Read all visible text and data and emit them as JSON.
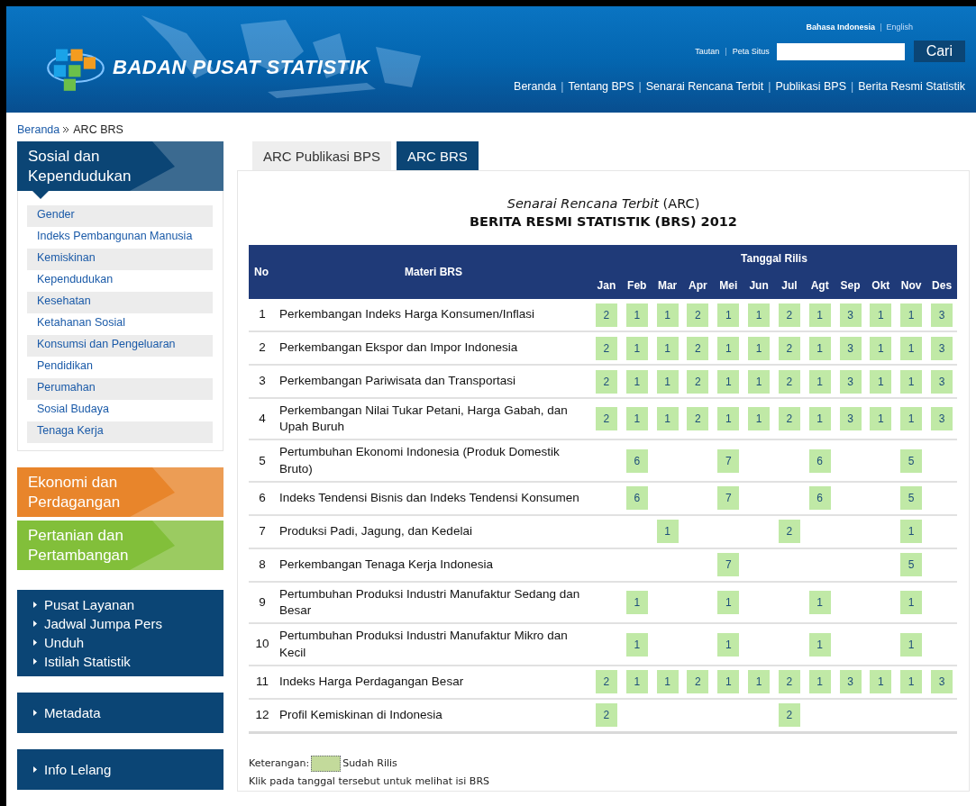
{
  "header": {
    "logo_text": "BADAN PUSAT STATISTIK",
    "languages": [
      {
        "kind": "link",
        "label": "Bahasa Indonesia",
        "selected": true
      },
      {
        "kind": "separator",
        "label": "|"
      },
      {
        "kind": "link",
        "label": "English",
        "selected": false
      }
    ],
    "utility_links": [
      {
        "kind": "link",
        "label": "Tautan"
      },
      {
        "kind": "separator",
        "label": "|"
      },
      {
        "kind": "link",
        "label": "Peta Situs"
      }
    ],
    "search_button": "Cari",
    "nav": [
      {
        "kind": "link",
        "label": "Beranda"
      },
      {
        "kind": "separator",
        "label": "|"
      },
      {
        "kind": "link",
        "label": "Tentang BPS"
      },
      {
        "kind": "separator",
        "label": "|"
      },
      {
        "kind": "link",
        "label": "Senarai Rencana Terbit"
      },
      {
        "kind": "separator",
        "label": "|"
      },
      {
        "kind": "link",
        "label": "Publikasi BPS"
      },
      {
        "kind": "separator",
        "label": "|"
      },
      {
        "kind": "link",
        "label": "Berita Resmi Statistik"
      }
    ]
  },
  "breadcrumb": [
    "Beranda",
    "ARC BRS"
  ],
  "sidebar": {
    "categories": [
      {
        "title": "Sosial dan Kependudukan",
        "color": "#0b4575",
        "expanded": true,
        "items": [
          "Gender",
          "Indeks Pembangunan Manusia",
          "Kemiskinan",
          "Kependudukan",
          "Kesehatan",
          "Ketahanan Sosial",
          "Konsumsi dan Pengeluaran",
          "Pendidikan",
          "Perumahan",
          "Sosial Budaya",
          "Tenaga Kerja"
        ]
      },
      {
        "title": "Ekonomi dan Perdagangan",
        "color": "#e8852b",
        "expanded": false
      },
      {
        "title": "Pertanian dan Pertambangan",
        "color": "#82bf3a",
        "expanded": false
      }
    ],
    "link_boxes": [
      [
        "Pusat Layanan",
        "Jadwal Jumpa Pers",
        "Unduh",
        "Istilah Statistik"
      ],
      [
        "Metadata"
      ],
      [
        "Info Lelang"
      ]
    ]
  },
  "tabs": [
    {
      "label": "ARC Publikasi BPS",
      "selected": false
    },
    {
      "label": "ARC BRS",
      "selected": true
    }
  ],
  "title": {
    "line1": "*Senarai Rencana Terbit* (ARC)",
    "line2": "BERITA RESMI STATISTIK (BRS) 2012"
  },
  "table": {
    "columns": {
      "no": "No",
      "subject": "Materi BRS",
      "group": "Tanggal Rilis",
      "months": [
        "Jan",
        "Feb",
        "Mar",
        "Apr",
        "Mei",
        "Jun",
        "Jul",
        "Agt",
        "Sep",
        "Okt",
        "Nov",
        "Des"
      ]
    },
    "rows": [
      {
        "no": "1",
        "subject": "Perkembangan Indeks Harga Konsumen/Inflasi",
        "dates": [
          {
            "released": true,
            "day": "2"
          },
          {
            "released": true,
            "day": "1"
          },
          {
            "released": true,
            "day": "1"
          },
          {
            "released": true,
            "day": "2"
          },
          {
            "released": true,
            "day": "1"
          },
          {
            "released": true,
            "day": "1"
          },
          {
            "released": true,
            "day": "2"
          },
          {
            "released": true,
            "day": "1"
          },
          {
            "released": true,
            "day": "3"
          },
          {
            "released": true,
            "day": "1"
          },
          {
            "released": true,
            "day": "1"
          },
          {
            "released": true,
            "day": "3"
          }
        ]
      },
      {
        "no": "2",
        "subject": "Perkembangan Ekspor dan Impor Indonesia",
        "dates": [
          {
            "released": true,
            "day": "2"
          },
          {
            "released": true,
            "day": "1"
          },
          {
            "released": true,
            "day": "1"
          },
          {
            "released": true,
            "day": "2"
          },
          {
            "released": true,
            "day": "1"
          },
          {
            "released": true,
            "day": "1"
          },
          {
            "released": true,
            "day": "2"
          },
          {
            "released": true,
            "day": "1"
          },
          {
            "released": true,
            "day": "3"
          },
          {
            "released": true,
            "day": "1"
          },
          {
            "released": true,
            "day": "1"
          },
          {
            "released": true,
            "day": "3"
          }
        ]
      },
      {
        "no": "3",
        "subject": "Perkembangan Pariwisata dan Transportasi",
        "dates": [
          {
            "released": true,
            "day": "2"
          },
          {
            "released": true,
            "day": "1"
          },
          {
            "released": true,
            "day": "1"
          },
          {
            "released": true,
            "day": "2"
          },
          {
            "released": true,
            "day": "1"
          },
          {
            "released": true,
            "day": "1"
          },
          {
            "released": true,
            "day": "2"
          },
          {
            "released": true,
            "day": "1"
          },
          {
            "released": true,
            "day": "3"
          },
          {
            "released": true,
            "day": "1"
          },
          {
            "released": true,
            "day": "1"
          },
          {
            "released": true,
            "day": "3"
          }
        ]
      },
      {
        "no": "4",
        "subject": "Perkembangan Nilai Tukar Petani, Harga Gabah, dan Upah Buruh",
        "dates": [
          {
            "released": true,
            "day": "2"
          },
          {
            "released": true,
            "day": "1"
          },
          {
            "released": true,
            "day": "1"
          },
          {
            "released": true,
            "day": "2"
          },
          {
            "released": true,
            "day": "1"
          },
          {
            "released": true,
            "day": "1"
          },
          {
            "released": true,
            "day": "2"
          },
          {
            "released": true,
            "day": "1"
          },
          {
            "released": true,
            "day": "3"
          },
          {
            "released": true,
            "day": "1"
          },
          {
            "released": true,
            "day": "1"
          },
          {
            "released": true,
            "day": "3"
          }
        ]
      },
      {
        "no": "5",
        "subject": "Pertumbuhan Ekonomi Indonesia (Produk Domestik Bruto)",
        "dates": [
          {
            "released": false
          },
          {
            "released": true,
            "day": "6"
          },
          {
            "released": false
          },
          {
            "released": false
          },
          {
            "released": true,
            "day": "7"
          },
          {
            "released": false
          },
          {
            "released": false
          },
          {
            "released": true,
            "day": "6"
          },
          {
            "released": false
          },
          {
            "released": false
          },
          {
            "released": true,
            "day": "5"
          },
          {
            "released": false
          }
        ]
      },
      {
        "no": "6",
        "subject": "Indeks Tendensi Bisnis dan Indeks Tendensi Konsumen",
        "dates": [
          {
            "released": false
          },
          {
            "released": true,
            "day": "6"
          },
          {
            "released": false
          },
          {
            "released": false
          },
          {
            "released": true,
            "day": "7"
          },
          {
            "released": false
          },
          {
            "released": false
          },
          {
            "released": true,
            "day": "6"
          },
          {
            "released": false
          },
          {
            "released": false
          },
          {
            "released": true,
            "day": "5"
          },
          {
            "released": false
          }
        ]
      },
      {
        "no": "7",
        "subject": "Produksi Padi, Jagung, dan Kedelai",
        "dates": [
          {
            "released": false
          },
          {
            "released": false
          },
          {
            "released": true,
            "day": "1"
          },
          {
            "released": false
          },
          {
            "released": false
          },
          {
            "released": false
          },
          {
            "released": true,
            "day": "2"
          },
          {
            "released": false
          },
          {
            "released": false
          },
          {
            "released": false
          },
          {
            "released": true,
            "day": "1"
          },
          {
            "released": false
          }
        ]
      },
      {
        "no": "8",
        "subject": "Perkembangan Tenaga Kerja Indonesia",
        "dates": [
          {
            "released": false
          },
          {
            "released": false
          },
          {
            "released": false
          },
          {
            "released": false
          },
          {
            "released": true,
            "day": "7"
          },
          {
            "released": false
          },
          {
            "released": false
          },
          {
            "released": false
          },
          {
            "released": false
          },
          {
            "released": false
          },
          {
            "released": true,
            "day": "5"
          },
          {
            "released": false
          }
        ]
      },
      {
        "no": "9",
        "subject": "Pertumbuhan Produksi Industri Manufaktur Sedang dan Besar",
        "dates": [
          {
            "released": false
          },
          {
            "released": true,
            "day": "1"
          },
          {
            "released": false
          },
          {
            "released": false
          },
          {
            "released": true,
            "day": "1"
          },
          {
            "released": false
          },
          {
            "released": false
          },
          {
            "released": true,
            "day": "1"
          },
          {
            "released": false
          },
          {
            "released": false
          },
          {
            "released": true,
            "day": "1"
          },
          {
            "released": false
          }
        ]
      },
      {
        "no": "10",
        "subject": "Pertumbuhan Produksi Industri Manufaktur Mikro dan Kecil",
        "dates": [
          {
            "released": false
          },
          {
            "released": true,
            "day": "1"
          },
          {
            "released": false
          },
          {
            "released": false
          },
          {
            "released": true,
            "day": "1"
          },
          {
            "released": false
          },
          {
            "released": false
          },
          {
            "released": true,
            "day": "1"
          },
          {
            "released": false
          },
          {
            "released": false
          },
          {
            "released": true,
            "day": "1"
          },
          {
            "released": false
          }
        ]
      },
      {
        "no": "11",
        "subject": "Indeks Harga Perdagangan Besar",
        "dates": [
          {
            "released": true,
            "day": "2"
          },
          {
            "released": true,
            "day": "1"
          },
          {
            "released": true,
            "day": "1"
          },
          {
            "released": true,
            "day": "2"
          },
          {
            "released": true,
            "day": "1"
          },
          {
            "released": true,
            "day": "1"
          },
          {
            "released": true,
            "day": "2"
          },
          {
            "released": true,
            "day": "1"
          },
          {
            "released": true,
            "day": "3"
          },
          {
            "released": true,
            "day": "1"
          },
          {
            "released": true,
            "day": "1"
          },
          {
            "released": true,
            "day": "3"
          }
        ]
      },
      {
        "no": "12",
        "subject": "Profil Kemiskinan di Indonesia",
        "dates": [
          {
            "released": true,
            "day": "2"
          },
          {
            "released": false
          },
          {
            "released": false
          },
          {
            "released": false
          },
          {
            "released": false
          },
          {
            "released": false
          },
          {
            "released": true,
            "day": "2"
          },
          {
            "released": false
          },
          {
            "released": false
          },
          {
            "released": false
          },
          {
            "released": false
          },
          {
            "released": false
          }
        ]
      }
    ]
  },
  "legend": {
    "label": "Keterangan:",
    "swatch_text": "Sudah Rilis",
    "note": "Klik pada tanggal tersebut untuk melihat isi BRS"
  }
}
